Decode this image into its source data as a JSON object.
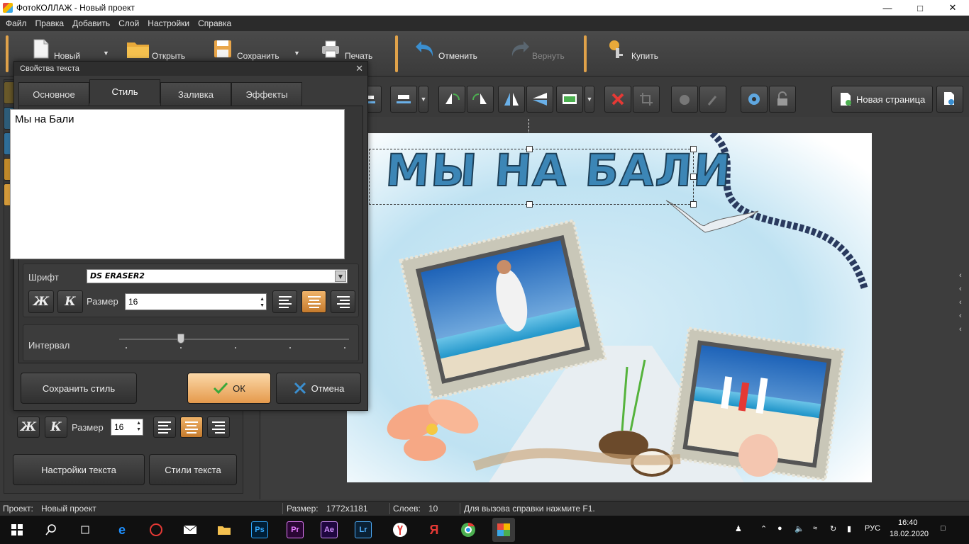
{
  "window": {
    "title": "ФотоКОЛЛАЖ - Новый проект"
  },
  "menu": [
    "Файл",
    "Правка",
    "Добавить",
    "Слой",
    "Настройки",
    "Справка"
  ],
  "toolbar": {
    "new": "Новый",
    "open": "Открыть",
    "save": "Сохранить",
    "print": "Печать",
    "undo": "Отменить",
    "redo": "Вернуть",
    "buy": "Купить"
  },
  "canvas_toolbar": {
    "new_page": "Новая страница"
  },
  "left_panel": {
    "size_label": "Размер",
    "size_value": "16",
    "bold": "Ж",
    "italic": "К",
    "text_settings": "Настройки текста",
    "text_styles": "Стили текста"
  },
  "dialog": {
    "title": "Свойства текста",
    "tabs": [
      "Основное",
      "Стиль",
      "Заливка",
      "Эффекты"
    ],
    "active_tab": "Стиль",
    "text": "Мы на Бали",
    "font_label": "Шрифт",
    "font_value": "DS ERASER2",
    "size_label": "Размер",
    "size_value": "16",
    "bold": "Ж",
    "italic": "К",
    "spacing_label": "Интервал",
    "spacing_level": 0.27,
    "save_style": "Сохранить стиль",
    "ok": "ОК",
    "cancel": "Отмена"
  },
  "collage": {
    "headline": "МЫ НА БАЛИ"
  },
  "statusbar": {
    "project_label": "Проект:",
    "project_value": "Новый проект",
    "size_label": "Размер:",
    "size_value": "1772x1181",
    "layers_label": "Слоев:",
    "layers_value": "10",
    "help": "Для вызова справки нажмите F1."
  },
  "taskbar": {
    "lang": "РУС",
    "time": "16:40",
    "date": "18.02.2020",
    "apps": [
      "Ps",
      "Pr",
      "Ae",
      "Lr"
    ]
  },
  "colors": {
    "accent": "#e0a24a",
    "headline": "#3c86b6"
  }
}
